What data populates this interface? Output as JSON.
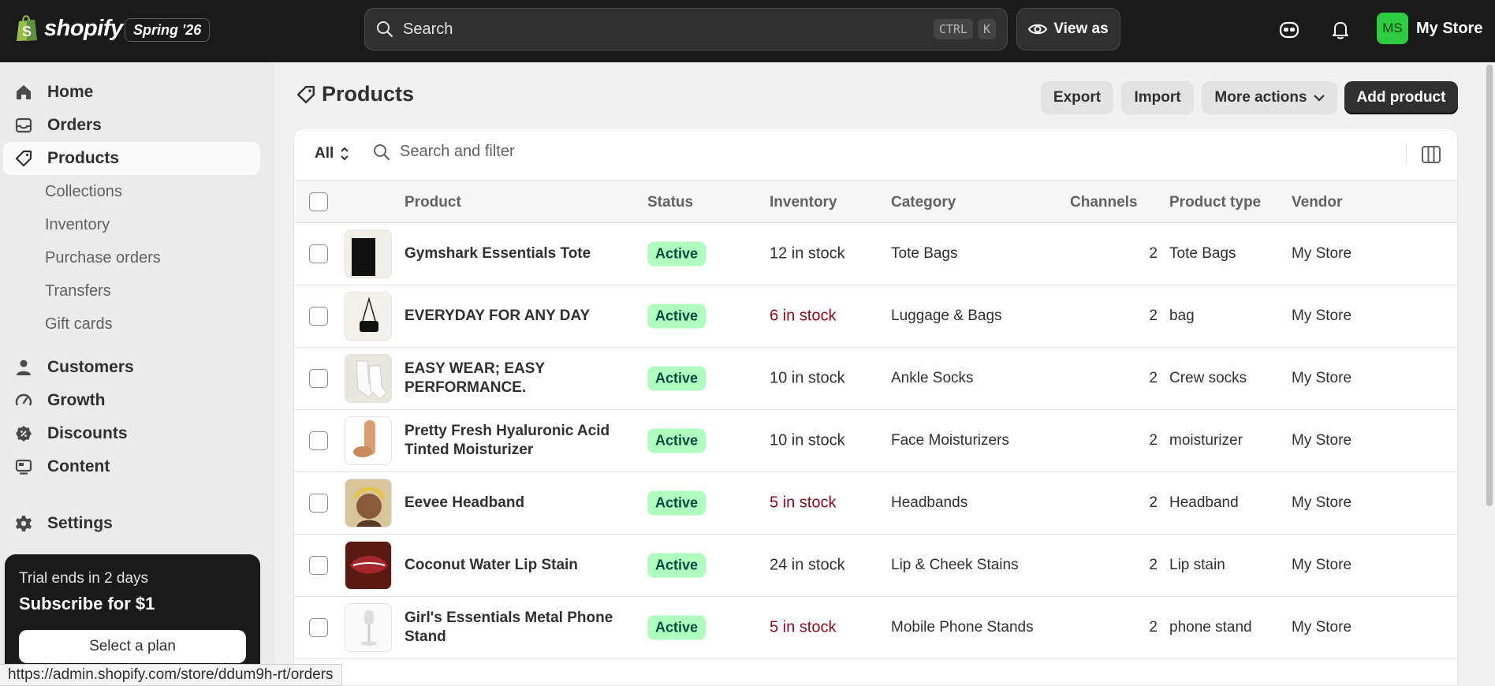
{
  "topbar": {
    "logo_text": "shopify",
    "edition": "Spring '26",
    "search_placeholder": "Search",
    "shortcut_ctrl": "CTRL",
    "shortcut_k": "K",
    "view_as": "View as",
    "store_initials": "MS",
    "store_name": "My Store",
    "avatar_color": "#2ecc40"
  },
  "sidebar": {
    "items": [
      {
        "label": "Home",
        "icon": "home-icon"
      },
      {
        "label": "Orders",
        "icon": "inbox-icon"
      },
      {
        "label": "Products",
        "icon": "tag-icon",
        "active": true
      }
    ],
    "sub_items": [
      "Collections",
      "Inventory",
      "Purchase orders",
      "Transfers",
      "Gift cards"
    ],
    "items2": [
      {
        "label": "Customers",
        "icon": "person-icon"
      },
      {
        "label": "Growth",
        "icon": "gauge-icon"
      },
      {
        "label": "Discounts",
        "icon": "discount-icon"
      },
      {
        "label": "Content",
        "icon": "monitor-icon"
      }
    ],
    "settings": "Settings",
    "trial": {
      "line1": "Trial ends in 2 days",
      "line2": "Subscribe for $1",
      "button": "Select a plan"
    }
  },
  "status_url": "https://admin.shopify.com/store/ddum9h-rt/orders",
  "main": {
    "title": "Products",
    "buttons": {
      "export": "Export",
      "import": "Import",
      "more_actions": "More actions",
      "add_product": "Add product"
    },
    "filter": {
      "view": "All",
      "search_placeholder": "Search and filter"
    },
    "columns": [
      "Product",
      "Status",
      "Inventory",
      "Category",
      "Channels",
      "Product type",
      "Vendor"
    ],
    "rows": [
      {
        "name": "Gymshark Essentials Tote",
        "status": "Active",
        "inventory": "12 in stock",
        "low": false,
        "category": "Tote Bags",
        "channels": "2",
        "type": "Tote Bags",
        "vendor": "My Store",
        "thumb": "tote"
      },
      {
        "name": "EVERYDAY FOR ANY DAY",
        "status": "Active",
        "inventory": "6 in stock",
        "low": true,
        "category": "Luggage & Bags",
        "channels": "2",
        "type": "bag",
        "vendor": "My Store",
        "thumb": "bag"
      },
      {
        "name": "EASY WEAR; EASY PERFORMANCE.",
        "status": "Active",
        "inventory": "10 in stock",
        "low": false,
        "category": "Ankle Socks",
        "channels": "2",
        "type": "Crew socks",
        "vendor": "My Store",
        "thumb": "socks"
      },
      {
        "name": "Pretty Fresh Hyaluronic Acid Tinted Moisturizer",
        "status": "Active",
        "inventory": "10 in stock",
        "low": false,
        "category": "Face Moisturizers",
        "channels": "2",
        "type": "moisturizer",
        "vendor": "My Store",
        "thumb": "moisturizer"
      },
      {
        "name": "Eevee Headband",
        "status": "Active",
        "inventory": "5 in stock",
        "low": true,
        "category": "Headbands",
        "channels": "2",
        "type": "Headband",
        "vendor": "My Store",
        "thumb": "headband"
      },
      {
        "name": "Coconut Water Lip Stain",
        "status": "Active",
        "inventory": "24 in stock",
        "low": false,
        "category": "Lip & Cheek Stains",
        "channels": "2",
        "type": "Lip stain",
        "vendor": "My Store",
        "thumb": "lips"
      },
      {
        "name": "Girl's Essentials Metal Phone Stand",
        "status": "Active",
        "inventory": "5 in stock",
        "low": true,
        "category": "Mobile Phone Stands",
        "channels": "2",
        "type": "phone stand",
        "vendor": "My Store",
        "thumb": "stand"
      }
    ]
  }
}
